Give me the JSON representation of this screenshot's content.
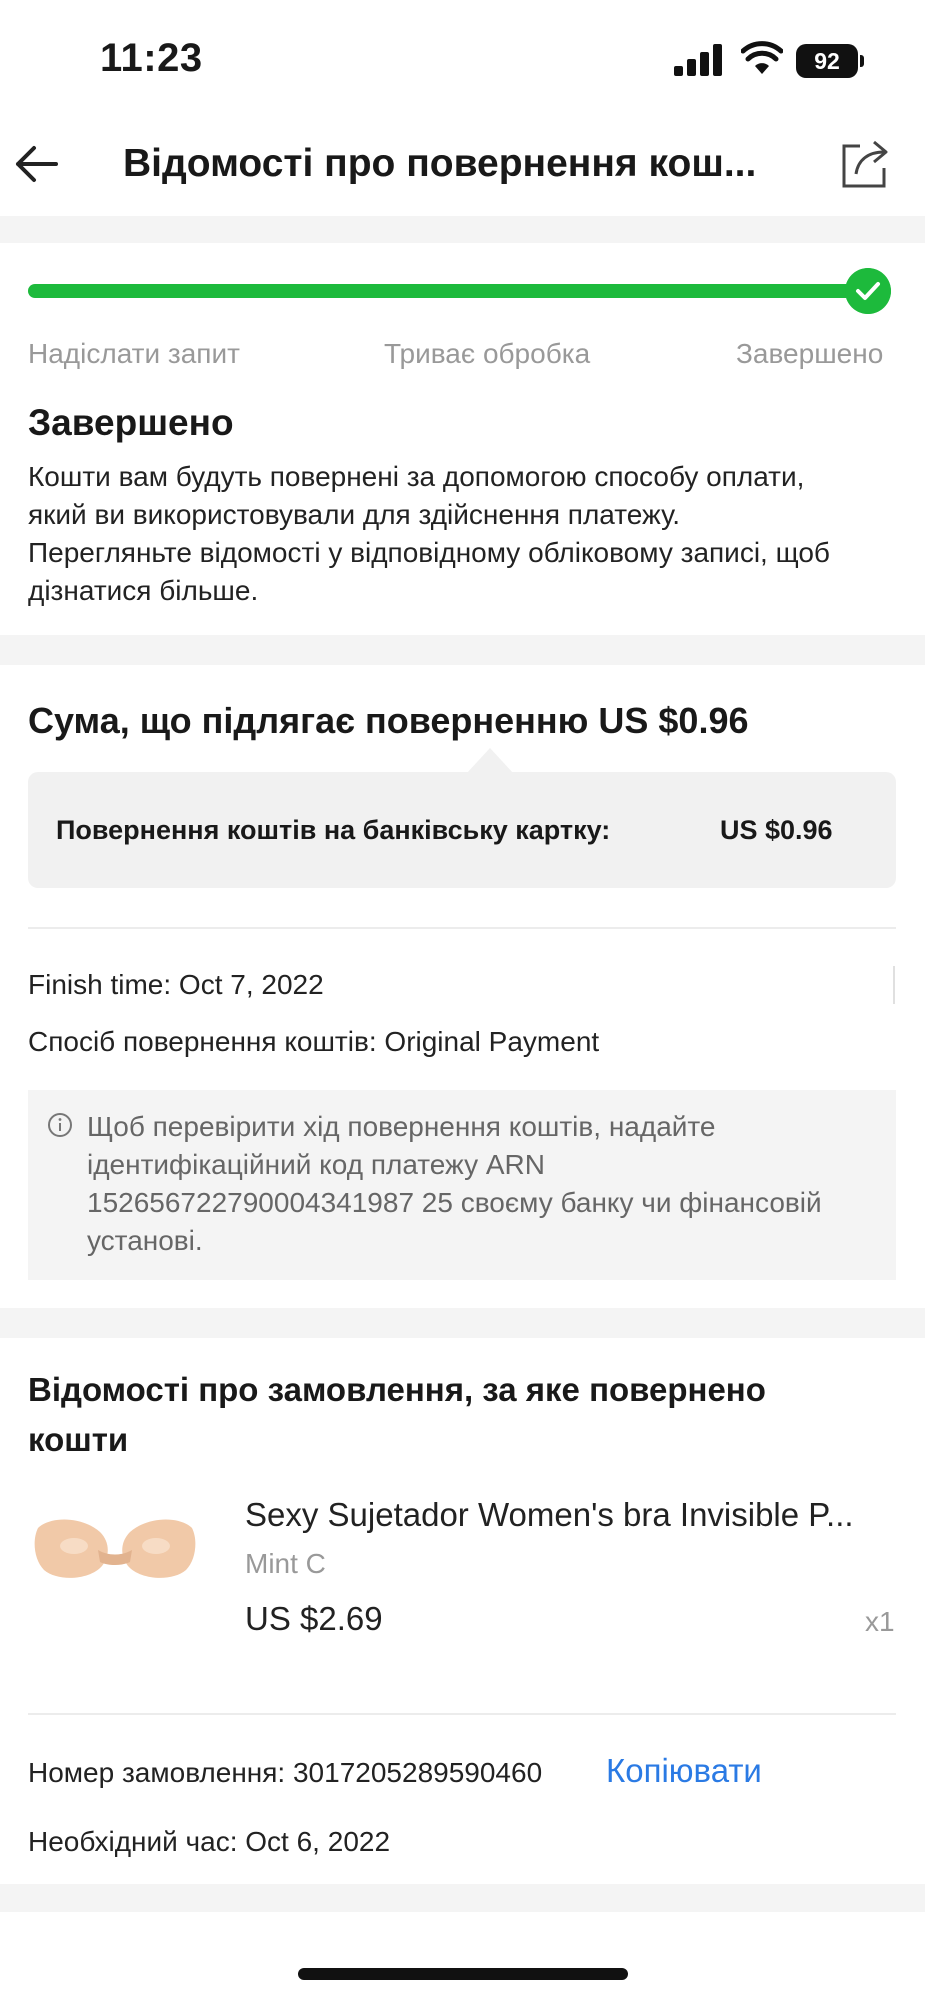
{
  "status_bar": {
    "time": "11:23",
    "battery": "92"
  },
  "nav": {
    "title": "Відомості про повернення кош..."
  },
  "progress": {
    "value": 1.0,
    "steps": [
      "Надіслати запит",
      "Триває обробка",
      "Завершено"
    ],
    "accent_color": "#1dba3c"
  },
  "status": {
    "title": "Завершено",
    "lines": [
      "Кошти вам будуть повернені за допомогою способу оплати,",
      "який ви використовували для здійснення платежу.",
      "Перегляньте відомості у відповідному обліковому записі, щоб",
      "дізнатися більше."
    ]
  },
  "refund": {
    "heading": "Сума, що підлягає поверненню US $0.96",
    "card_label": "Повернення коштів на банківську картку:",
    "card_amount": "US $0.96",
    "finish_time": "Finish time: Oct 7, 2022",
    "method": "Спосіб повернення коштів: Original Payment",
    "info_lines": [
      "Щоб перевірити хід повернення коштів, надайте",
      "ідентифікаційний код платежу ARN",
      "152656722790004341987 25 своєму банку чи фінансовій",
      "установі."
    ]
  },
  "order": {
    "heading_lines": [
      "Відомості про замовлення, за яке повернено",
      "кошти"
    ],
    "product": {
      "title": "Sexy Sujetador Women's bra Invisible P...",
      "variant": "Mint C",
      "price": "US $2.69",
      "qty": "x1"
    },
    "order_number": "Номер замовлення: 3017205289590460",
    "copy_label": "Копіювати",
    "required_time": "Необхідний час: Oct 6, 2022"
  }
}
